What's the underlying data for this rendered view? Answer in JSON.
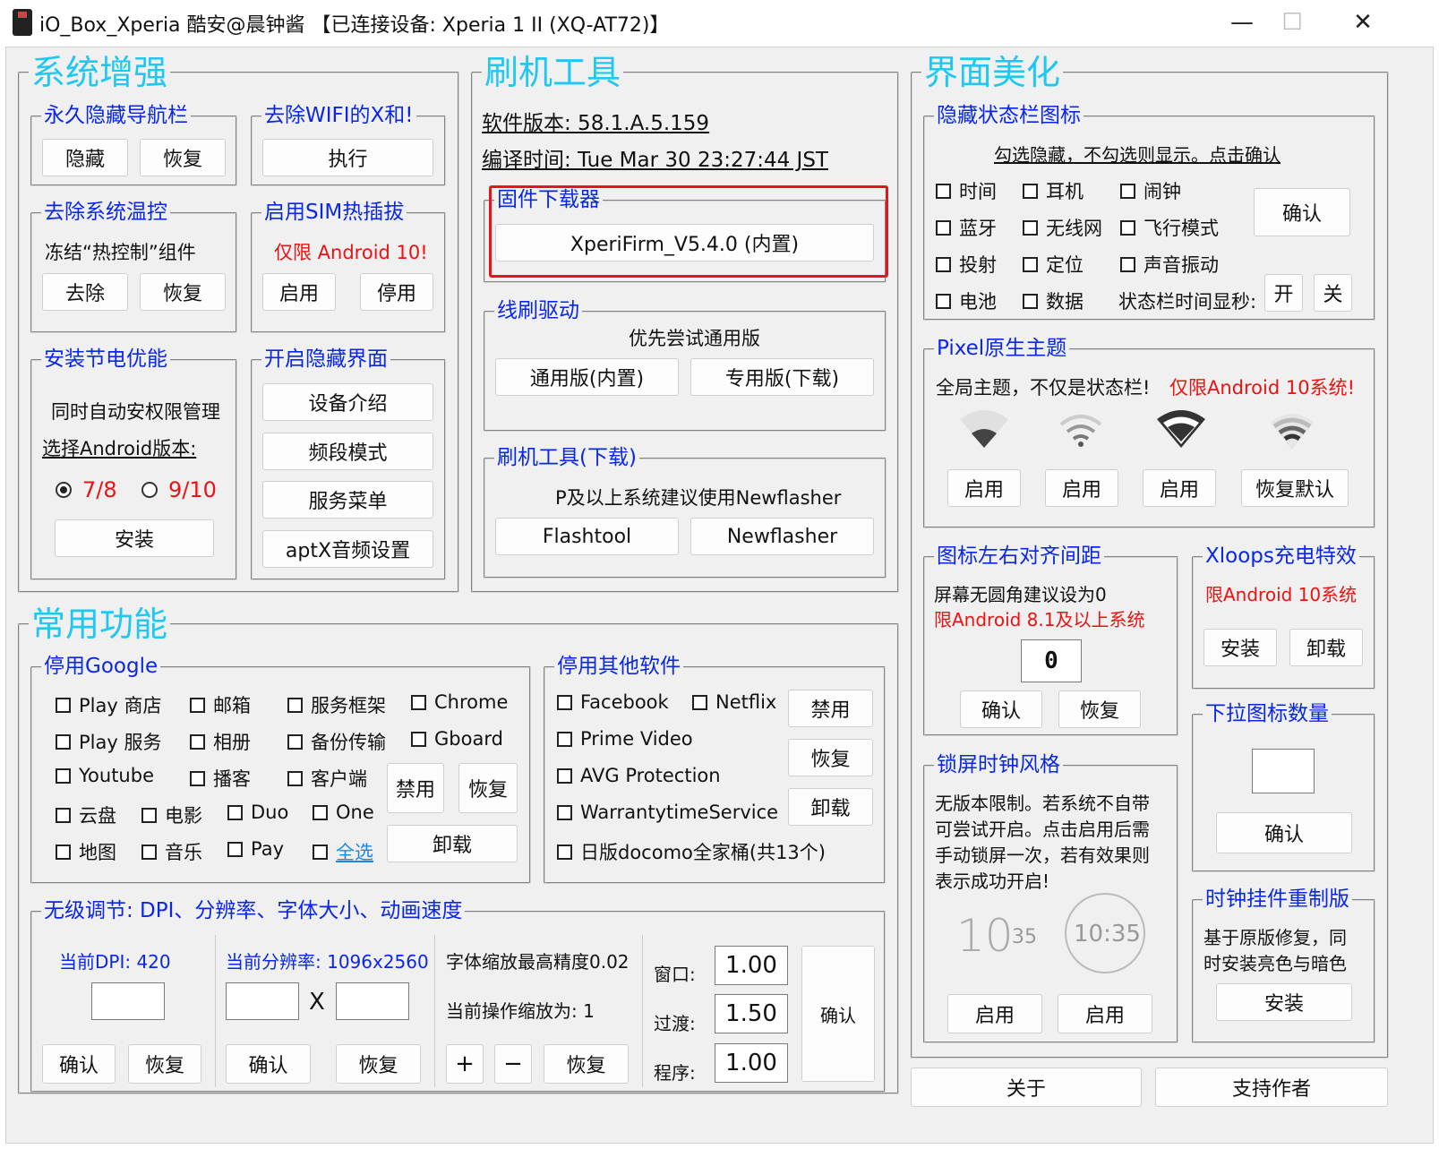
{
  "window": {
    "title": "iO_Box_Xperia  酷安@晨钟酱 【已连接设备: Xperia 1 II (XQ-AT72)】",
    "minimize": "—",
    "maximize": "☐",
    "close": "✕"
  },
  "system": {
    "title": "系统增强",
    "nav": {
      "title": "永久隐藏导航栏",
      "hide": "隐藏",
      "restore": "恢复"
    },
    "wifi": {
      "title": "去除WIFI的X和!",
      "run": "执行"
    },
    "thermal": {
      "title": "去除系统温控",
      "desc": "冻结“热控制”组件",
      "remove": "去除",
      "restore": "恢复"
    },
    "sim": {
      "title": "启用SIM热插拔",
      "note": "仅限 Android 10!",
      "enable": "启用",
      "disable": "停用"
    },
    "power": {
      "title": "安装节电优能",
      "desc": "同时自动安权限管理",
      "choose": "选择Android版本:",
      "opt1": "7/8",
      "opt2": "9/10",
      "install": "安装"
    },
    "hidden": {
      "title": "开启隐藏界面",
      "b1": "设备介绍",
      "b2": "频段模式",
      "b3": "服务菜单",
      "b4": "aptX音频设置"
    }
  },
  "flash": {
    "title": "刷机工具",
    "version": "软件版本: 58.1.A.5.159",
    "build": "编译时间: Tue Mar 30 23:27:44 JST",
    "firmware": {
      "title": "固件下载器",
      "button": "XperiFirm_V5.4.0 (内置)"
    },
    "driver": {
      "title": "线刷驱动",
      "note": "优先尝试通用版",
      "generic": "通用版(内置)",
      "special": "专用版(下载)"
    },
    "tools": {
      "title": "刷机工具(下载)",
      "note": "P及以上系统建议使用Newflasher",
      "flashtool": "Flashtool",
      "newflasher": "Newflasher"
    }
  },
  "ui": {
    "title": "界面美化",
    "statusbar": {
      "title": "隐藏状态栏图标",
      "note": "勾选隐藏，不勾选则显示。点击确认",
      "items": [
        "时间",
        "耳机",
        "闹钟",
        "蓝牙",
        "无线网",
        "飞行模式",
        "投射",
        "定位",
        "声音振动",
        "电池",
        "数据"
      ],
      "confirm": "确认",
      "seconds": "状态栏时间显秒:",
      "on": "开",
      "off": "关"
    },
    "pixel": {
      "title": "Pixel原生主题",
      "desc": "全局主题，不仅是状态栏!",
      "note": "仅限Android 10系统!",
      "enable1": "启用",
      "enable2": "启用",
      "enable3": "启用",
      "reset": "恢复默认"
    },
    "iconspacing": {
      "title": "图标左右对齐间距",
      "desc": "屏幕无圆角建议设为0",
      "note": "限Android 8.1及以上系统",
      "value": "0",
      "confirm": "确认",
      "restore": "恢复"
    },
    "xloops": {
      "title": "Xloops充电特效",
      "note": "限Android 10系统",
      "install": "安装",
      "uninstall": "卸载"
    },
    "pulldown": {
      "title": "下拉图标数量",
      "value": "",
      "confirm": "确认"
    },
    "lockclock": {
      "title": "锁屏时钟风格",
      "desc1": "无版本限制。若系统不自带",
      "desc2": "可尝试开启。点击启用后需",
      "desc3": "手动锁屏一次，若有效果则",
      "desc4": "表示成功开启!",
      "clock1_big": "10",
      "clock1_small": "35",
      "clock2": "10:35",
      "enable1": "启用",
      "enable2": "启用"
    },
    "clockwidget": {
      "title": "时钟挂件重制版",
      "desc1": "基于原版修复，同",
      "desc2": "时安装亮色与暗色",
      "install": "安装"
    }
  },
  "common": {
    "title": "常用功能",
    "google": {
      "title": "停用Google",
      "items": [
        "Play 商店",
        "邮箱",
        "服务框架",
        "Chrome",
        "Play 服务",
        "相册",
        "备份传输",
        "Gboard",
        "Youtube",
        "播客",
        "客户端",
        "云盘",
        "电影",
        "Duo",
        "One",
        "地图",
        "音乐",
        "Pay",
        "全选"
      ],
      "disable": "禁用",
      "restore": "恢复",
      "uninstall": "卸载"
    },
    "other": {
      "title": "停用其他软件",
      "items": [
        "Facebook",
        "Netflix",
        "Prime Video",
        "AVG Protection",
        "WarrantytimeService",
        "日版docomo全家桶(共13个)"
      ],
      "disable": "禁用",
      "restore": "恢复",
      "uninstall": "卸载"
    },
    "tuning": {
      "title": "无级调节: DPI、分辨率、字体大小、动画速度",
      "dpi_label": "当前DPI:   420",
      "dpi_confirm": "确认",
      "dpi_restore": "恢复",
      "res_label": "当前分辨率: 1096x2560",
      "res_x": "X",
      "res_confirm": "确认",
      "res_restore": "恢复",
      "font_precision": "字体缩放最高精度0.02",
      "font_current": "当前操作缩放为: 1",
      "plus": "+",
      "minus": "−",
      "font_restore": "恢复",
      "window_label": "窗口:",
      "window_value": "1.00",
      "transition_label": "过渡:",
      "transition_value": "1.50",
      "program_label": "程序:",
      "program_value": "1.00",
      "anim_confirm": "确认"
    }
  },
  "footer": {
    "about": "关于",
    "support": "支持作者"
  },
  "colors": {
    "legend_big": "#1ec8f0",
    "legend": "#0a27e8",
    "warning": "#e11111",
    "highlight": "#e8141b"
  }
}
